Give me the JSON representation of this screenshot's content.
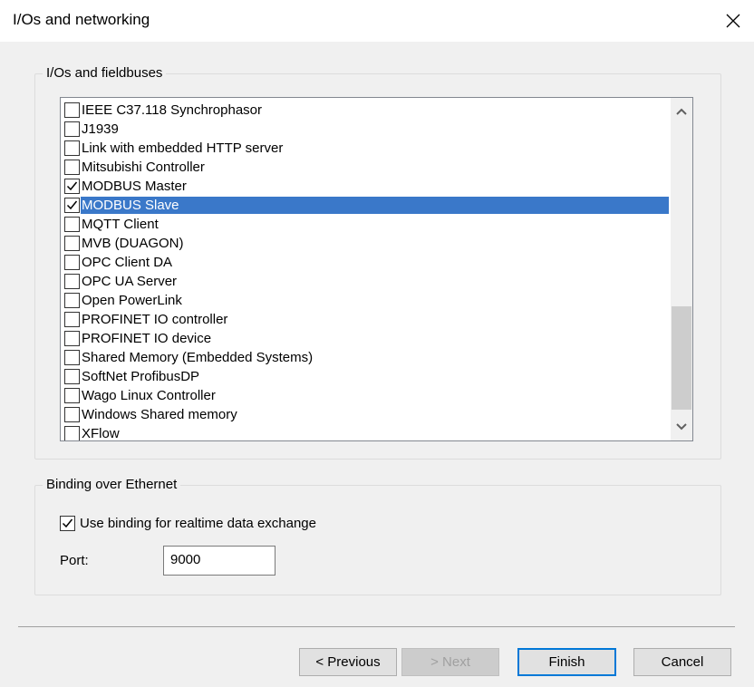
{
  "window": {
    "title": "I/Os and networking"
  },
  "io_group": {
    "legend": "I/Os and fieldbuses",
    "items": [
      {
        "label": "IEEE C37.118 Synchrophasor",
        "checked": false,
        "selected": false
      },
      {
        "label": "J1939",
        "checked": false,
        "selected": false
      },
      {
        "label": "Link with embedded HTTP server",
        "checked": false,
        "selected": false
      },
      {
        "label": "Mitsubishi Controller",
        "checked": false,
        "selected": false
      },
      {
        "label": "MODBUS Master",
        "checked": true,
        "selected": false
      },
      {
        "label": "MODBUS Slave",
        "checked": true,
        "selected": true
      },
      {
        "label": "MQTT Client",
        "checked": false,
        "selected": false
      },
      {
        "label": "MVB (DUAGON)",
        "checked": false,
        "selected": false
      },
      {
        "label": "OPC Client DA",
        "checked": false,
        "selected": false
      },
      {
        "label": "OPC UA Server",
        "checked": false,
        "selected": false
      },
      {
        "label": "Open PowerLink",
        "checked": false,
        "selected": false
      },
      {
        "label": "PROFINET IO controller",
        "checked": false,
        "selected": false
      },
      {
        "label": "PROFINET IO device",
        "checked": false,
        "selected": false
      },
      {
        "label": "Shared Memory (Embedded Systems)",
        "checked": false,
        "selected": false
      },
      {
        "label": "SoftNet ProfibusDP",
        "checked": false,
        "selected": false
      },
      {
        "label": "Wago Linux Controller",
        "checked": false,
        "selected": false
      },
      {
        "label": "Windows Shared memory",
        "checked": false,
        "selected": false
      },
      {
        "label": "XFlow",
        "checked": false,
        "selected": false
      }
    ]
  },
  "binding_group": {
    "legend": "Binding over Ethernet",
    "use_binding_label": "Use binding for realtime data exchange",
    "use_binding_checked": true,
    "port_label": "Port:",
    "port_value": "9000"
  },
  "buttons": {
    "previous": "< Previous",
    "next": "> Next",
    "finish": "Finish",
    "cancel": "Cancel"
  },
  "colors": {
    "selection": "#3a78c9",
    "default_button_border": "#0078d7"
  }
}
